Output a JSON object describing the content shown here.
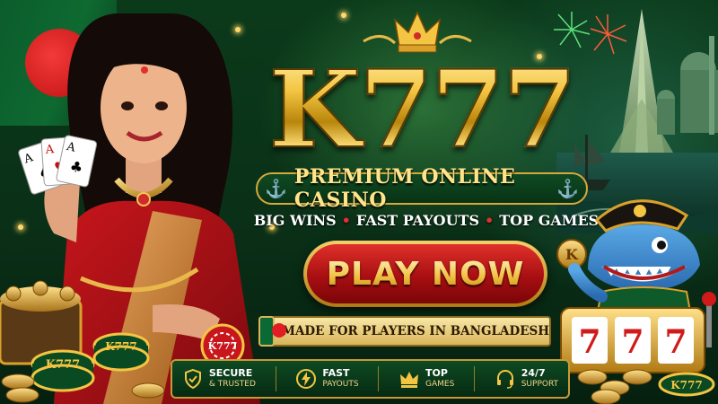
{
  "brand": {
    "logo_text": "K777",
    "subtitle": "PREMIUM ONLINE CASINO",
    "features_line": [
      "BIG WINS",
      "FAST PAYOUTS",
      "TOP GAMES"
    ]
  },
  "cta": {
    "label": "PLAY NOW"
  },
  "made_for": {
    "text": "MADE FOR PLAYERS IN BANGLADESH"
  },
  "features": [
    {
      "title": "SECURE",
      "sub": "& TRUSTED",
      "icon": "shield-check-icon"
    },
    {
      "title": "FAST",
      "sub": "PAYOUTS",
      "icon": "lightning-icon"
    },
    {
      "title": "TOP",
      "sub": "GAMES",
      "icon": "crown-icon"
    },
    {
      "title": "24/7",
      "sub": "SUPPORT",
      "icon": "headset-icon"
    }
  ],
  "chip_label": "K777",
  "slot_reels": [
    "7",
    "7",
    "7"
  ],
  "cards": [
    "A",
    "A",
    "A"
  ],
  "mascot_coin": "K",
  "colors": {
    "gold": "#f4c542",
    "green": "#0b3a1a",
    "red": "#c01010",
    "cream": "#f8e7a6"
  }
}
